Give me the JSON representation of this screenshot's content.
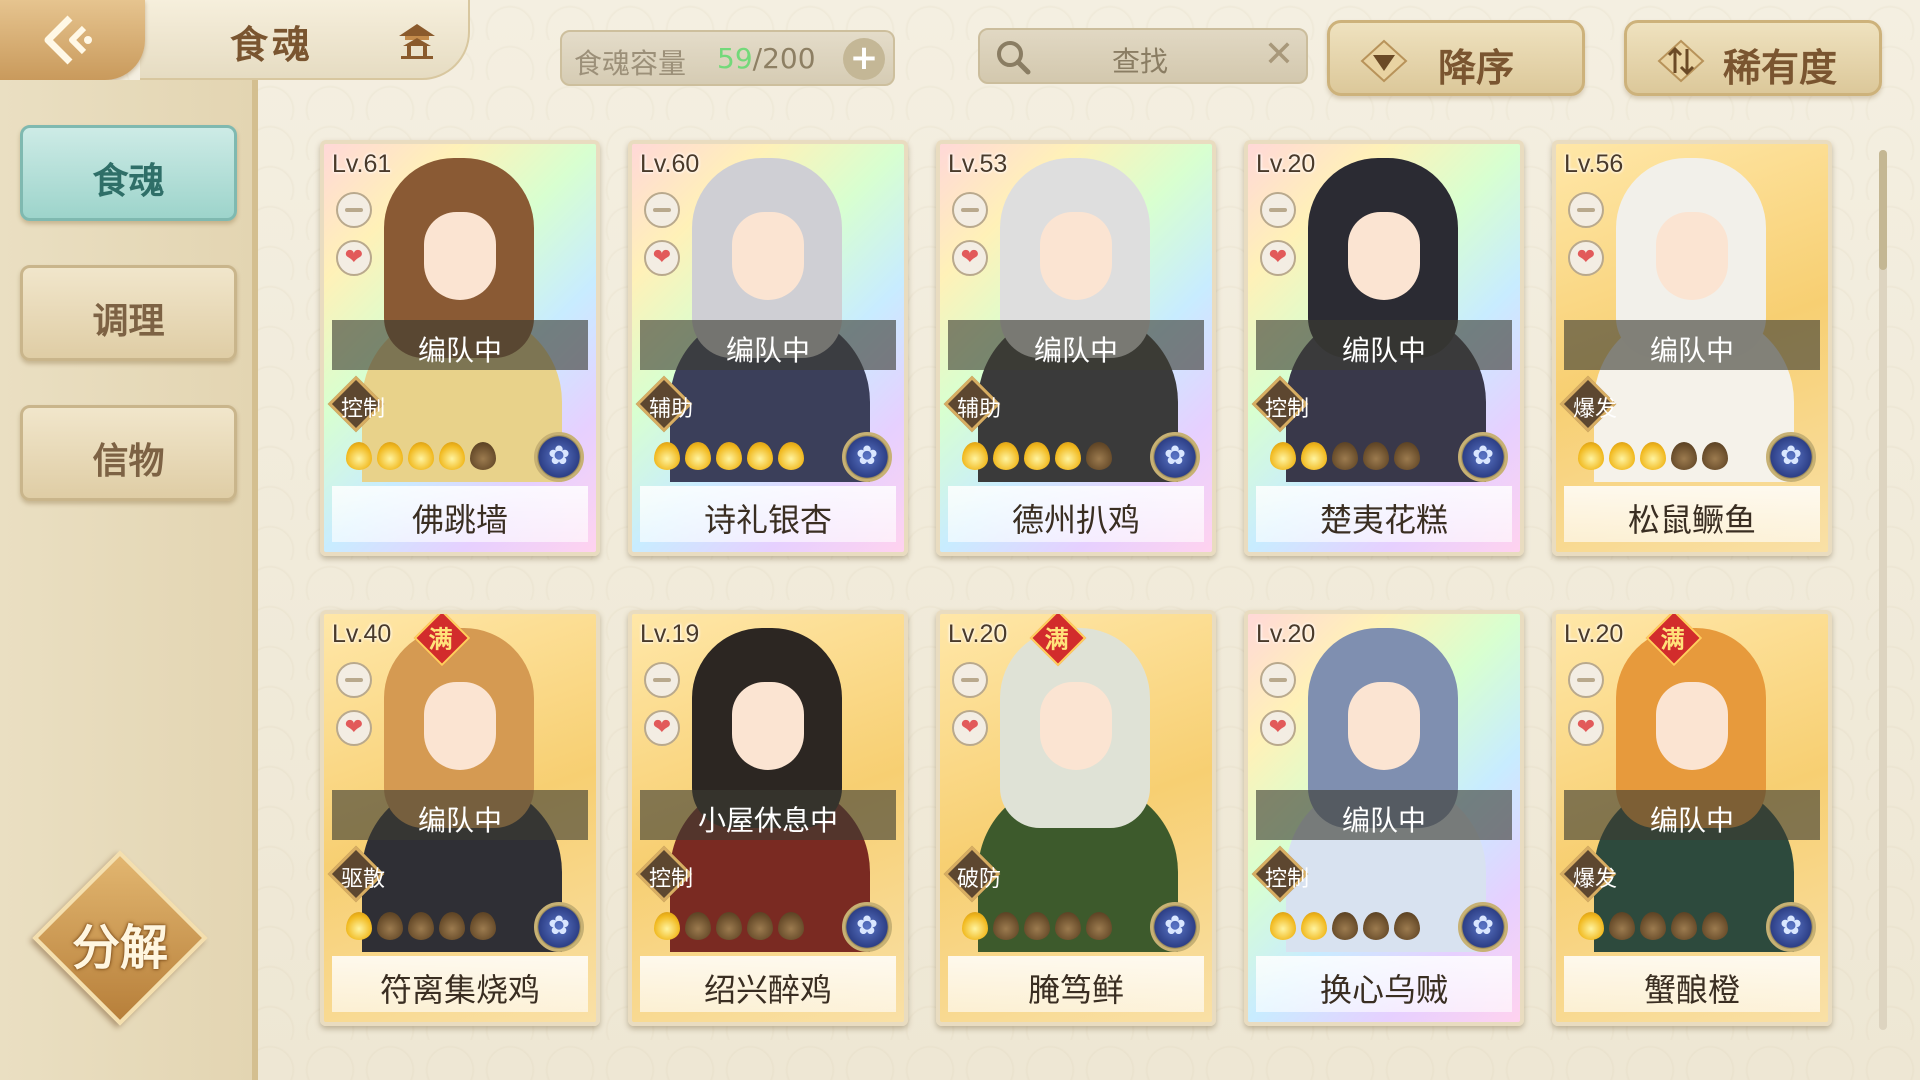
{
  "header": {
    "title": "食魂",
    "capacity_label": "食魂容量",
    "capacity_current": "59",
    "capacity_max": "/200",
    "capacity_add": "+",
    "search_text": "查找",
    "search_clear": "✕",
    "sort_order_label": "降序",
    "sort_by_label": "稀有度"
  },
  "sidebar": {
    "tabs": [
      {
        "label": "食魂"
      },
      {
        "label": "调理"
      },
      {
        "label": "信物"
      }
    ],
    "decompose_label": "分解"
  },
  "cards": [
    {
      "level": "Lv.61",
      "status": "编队中",
      "role": "控制",
      "name": "佛跳墙",
      "stars_on": 4,
      "stars_total": 5,
      "full": false,
      "style": "rainbow",
      "hair": "#8a5a34",
      "body": "#e8d28a"
    },
    {
      "level": "Lv.60",
      "status": "编队中",
      "role": "辅助",
      "name": "诗礼银杏",
      "stars_on": 5,
      "stars_total": 5,
      "full": false,
      "style": "rainbow",
      "hair": "#cfcfd4",
      "body": "#3b3f5a"
    },
    {
      "level": "Lv.53",
      "status": "编队中",
      "role": "辅助",
      "name": "德州扒鸡",
      "stars_on": 4,
      "stars_total": 5,
      "full": false,
      "style": "rainbow",
      "hair": "#dedede",
      "body": "#3a3a3a"
    },
    {
      "level": "Lv.20",
      "status": "编队中",
      "role": "控制",
      "name": "楚夷花糕",
      "stars_on": 2,
      "stars_total": 5,
      "full": false,
      "style": "rainbow",
      "hair": "#2b2b33",
      "body": "#39384a"
    },
    {
      "level": "Lv.56",
      "status": "编队中",
      "role": "爆发",
      "name": "松鼠鳜鱼",
      "stars_on": 3,
      "stars_total": 5,
      "full": false,
      "style": "gold",
      "hair": "#f2f0ea",
      "body": "#f5f2ea"
    },
    {
      "level": "Lv.40",
      "status": "编队中",
      "role": "驱散",
      "name": "符离集烧鸡",
      "stars_on": 1,
      "stars_total": 5,
      "full": true,
      "style": "gold",
      "hair": "#d59a52",
      "body": "#2f2f35"
    },
    {
      "level": "Lv.19",
      "status": "小屋休息中",
      "role": "控制",
      "name": "绍兴醉鸡",
      "stars_on": 1,
      "stars_total": 5,
      "full": false,
      "style": "gold",
      "hair": "#2c2622",
      "body": "#7a2a22"
    },
    {
      "level": "Lv.20",
      "status": "",
      "role": "破防",
      "name": "腌笃鲜",
      "stars_on": 1,
      "stars_total": 5,
      "full": true,
      "style": "gold",
      "hair": "#dfe2d6",
      "body": "#3d5a2c"
    },
    {
      "level": "Lv.20",
      "status": "编队中",
      "role": "控制",
      "name": "换心乌贼",
      "stars_on": 2,
      "stars_total": 5,
      "full": false,
      "style": "rainbow",
      "hair": "#7f8fb0",
      "body": "#d8e2f0"
    },
    {
      "level": "Lv.20",
      "status": "编队中",
      "role": "爆发",
      "name": "蟹酿橙",
      "stars_on": 1,
      "stars_total": 5,
      "full": true,
      "style": "gold",
      "hair": "#e79a3c",
      "body": "#2d4a3d"
    }
  ],
  "colors": {
    "accent_teal": "#9dd4cb",
    "gold": "#d7ad62",
    "capacity_green": "#73d97a"
  }
}
